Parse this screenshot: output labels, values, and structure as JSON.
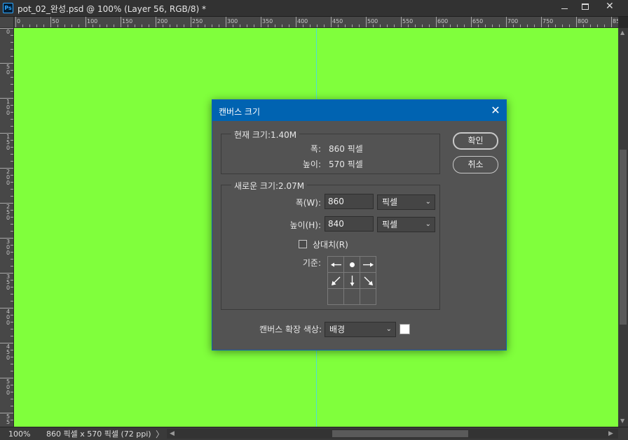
{
  "window": {
    "app_icon": "Ps",
    "title": "pot_02_완성.psd @ 100% (Layer 56, RGB/8) *",
    "controls": [
      "minimize-icon",
      "maximize-icon",
      "close-icon"
    ]
  },
  "ruler_top": {
    "labels": [
      "0",
      "50",
      "100",
      "150",
      "200",
      "250",
      "300",
      "350",
      "400",
      "450",
      "500",
      "550",
      "600",
      "650",
      "700",
      "750",
      "800",
      "85"
    ]
  },
  "ruler_left": {
    "labels": [
      "0",
      "50",
      "100",
      "150",
      "200",
      "250",
      "300",
      "350",
      "400",
      "450",
      "500",
      "55"
    ]
  },
  "canvas": {
    "fill_color": "#80ff3c",
    "guide_color": "#4ee0d6"
  },
  "status": {
    "zoom": "100%",
    "doc_info": "860 픽셀 x 570 픽셀 (72 ppi)",
    "arrow": "〉"
  },
  "dialog": {
    "title": "캔버스 크기",
    "current": {
      "legend": "현재 크기:1.40M",
      "width_label": "폭:",
      "width_value": "860 픽셀",
      "height_label": "높이:",
      "height_value": "570 픽셀"
    },
    "new_size": {
      "legend": "새로운 크기:2.07M",
      "width_label": "폭(W):",
      "width_value": "860",
      "width_unit": "픽셀",
      "height_label": "높이(H):",
      "height_value": "840",
      "height_unit": "픽셀",
      "relative_label": "상대치(R)",
      "relative_checked": false,
      "anchor_label": "기준:",
      "anchor_position": "top-center"
    },
    "extension_color": {
      "label": "캔버스 확장 색상:",
      "value": "배경",
      "swatch": "#ffffff"
    },
    "buttons": {
      "ok": "확인",
      "cancel": "취소"
    },
    "accent": "#0063b1"
  }
}
